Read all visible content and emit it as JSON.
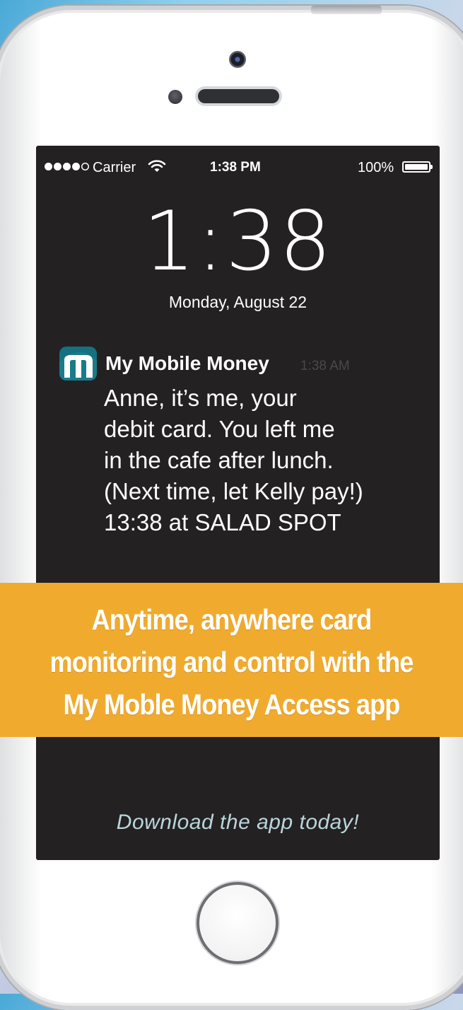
{
  "status_bar": {
    "carrier": "Carrier",
    "time": "1:38 PM",
    "battery": "100%",
    "signal_bars": 4,
    "signal_total": 5,
    "icons": [
      "signal-dots-icon",
      "wifi-icon",
      "battery-icon"
    ]
  },
  "lock_screen": {
    "time": "1:38",
    "date": "Monday, August 22"
  },
  "notification": {
    "app_name": "My Mobile Money",
    "time": "1:38 AM",
    "icon": "my-mobile-money-app-icon",
    "body_lines": [
      "Anne, it’s me, your",
      "debit card. You left me",
      "in the cafe after lunch.",
      "(Next time, let Kelly pay!)",
      "13:38 at SALAD SPOT"
    ]
  },
  "banner": {
    "lines": [
      "Anytime, anywhere card",
      "monitoring and control with the",
      "My Moble Money Access app"
    ]
  },
  "download_text": "Download the app today!",
  "colors": {
    "screen_bg": "#242123",
    "banner_bg": "#f0ab2e",
    "app_icon_bg": "#1a7b8a",
    "download_text": "#b9d6dc"
  }
}
